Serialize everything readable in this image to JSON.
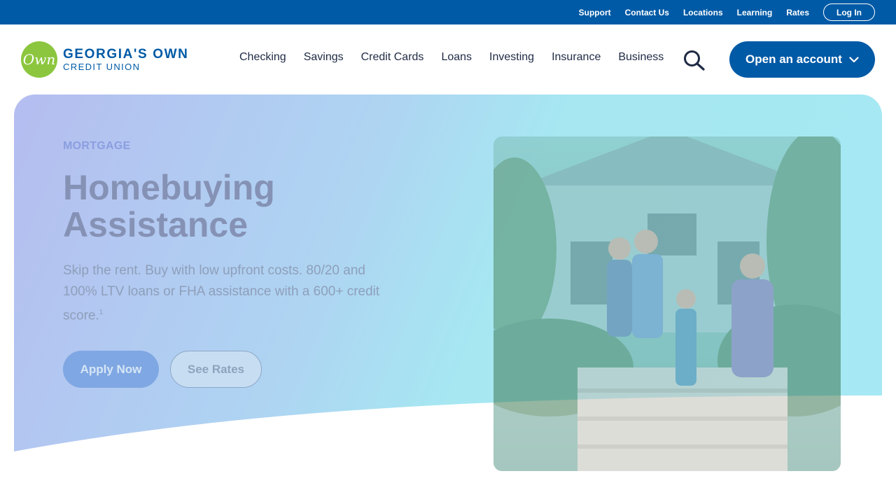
{
  "utility": {
    "links": [
      "Support",
      "Contact Us",
      "Locations",
      "Learning",
      "Rates"
    ],
    "login_label": "Log In"
  },
  "brand": {
    "logo_mark": "Own",
    "name_line1": "GEORGIA'S OWN",
    "name_line2": "CREDIT UNION",
    "colors": {
      "primary": "#005aa6",
      "logo_green": "#8cc63f"
    }
  },
  "nav": {
    "items": [
      "Checking",
      "Savings",
      "Credit Cards",
      "Loans",
      "Investing",
      "Insurance",
      "Business"
    ],
    "search_icon": "search-icon",
    "cta_label": "Open an account",
    "cta_icon": "chevron-down-icon"
  },
  "hero": {
    "eyebrow": "MORTGAGE",
    "title": "Homebuying Assistance",
    "body": "Skip the rent. Buy with low upfront costs. 80/20 and 100% LTV loans or FHA assistance with a 600+ credit score.",
    "footnote": "1",
    "primary_button": "Apply Now",
    "secondary_button": "See Rates",
    "image_alt": "family-on-house-steps"
  }
}
